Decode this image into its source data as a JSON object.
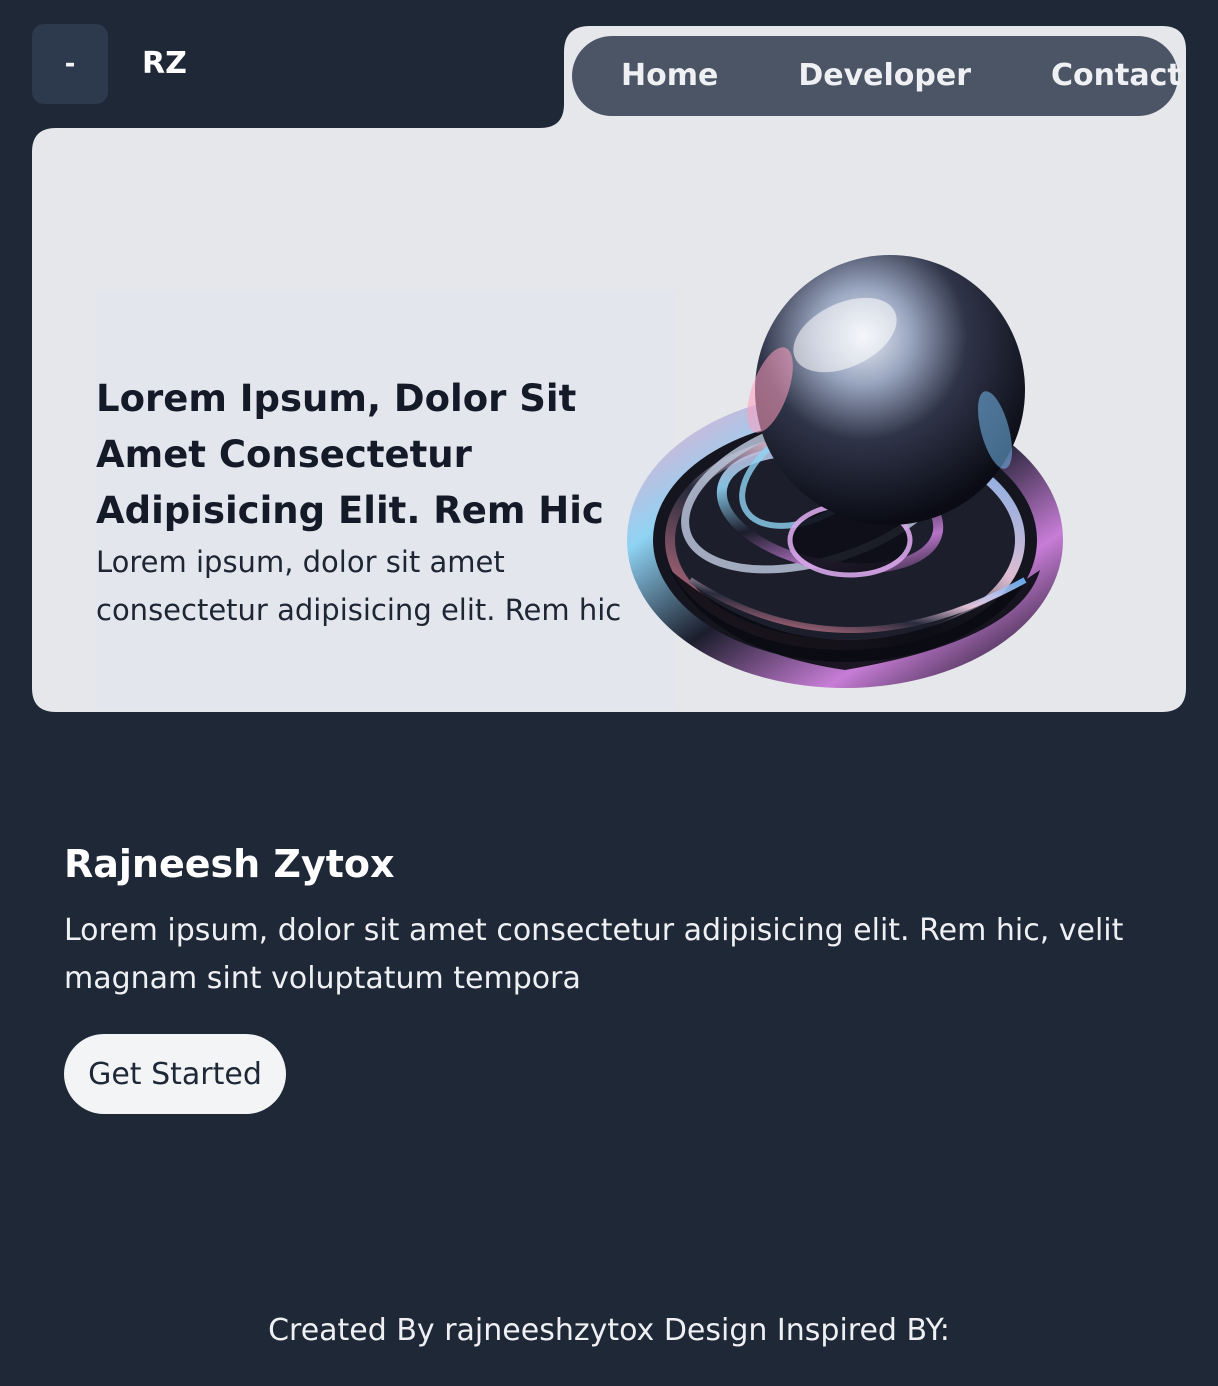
{
  "header": {
    "menu_label": "-",
    "brand": "RZ"
  },
  "nav": {
    "items": [
      {
        "label": "Home"
      },
      {
        "label": "Developer"
      },
      {
        "label": "Contact"
      }
    ]
  },
  "hero": {
    "title": "Lorem Ipsum, Dolor Sit Amet Consectetur Adipisicing Elit. Rem Hic",
    "subtitle": "Lorem ipsum, dolor sit amet consectetur adipisicing elit. Rem hic"
  },
  "profile": {
    "name": "Rajneesh Zytox",
    "description": "Lorem ipsum, dolor sit amet consectetur adipisicing elit. Rem hic, velit magnam sint voluptatum tempora",
    "cta_label": "Get Started"
  },
  "footer": {
    "text": "Created By rajneeshzytox Design Inspired BY:"
  },
  "colors": {
    "background": "#1f2837",
    "card": "#e6e7eb",
    "nav": "#4b5565",
    "menu_button": "#2d3a4d",
    "button": "#f3f4f6"
  },
  "icons": {
    "hero_art": "glass-torus-illustration"
  }
}
